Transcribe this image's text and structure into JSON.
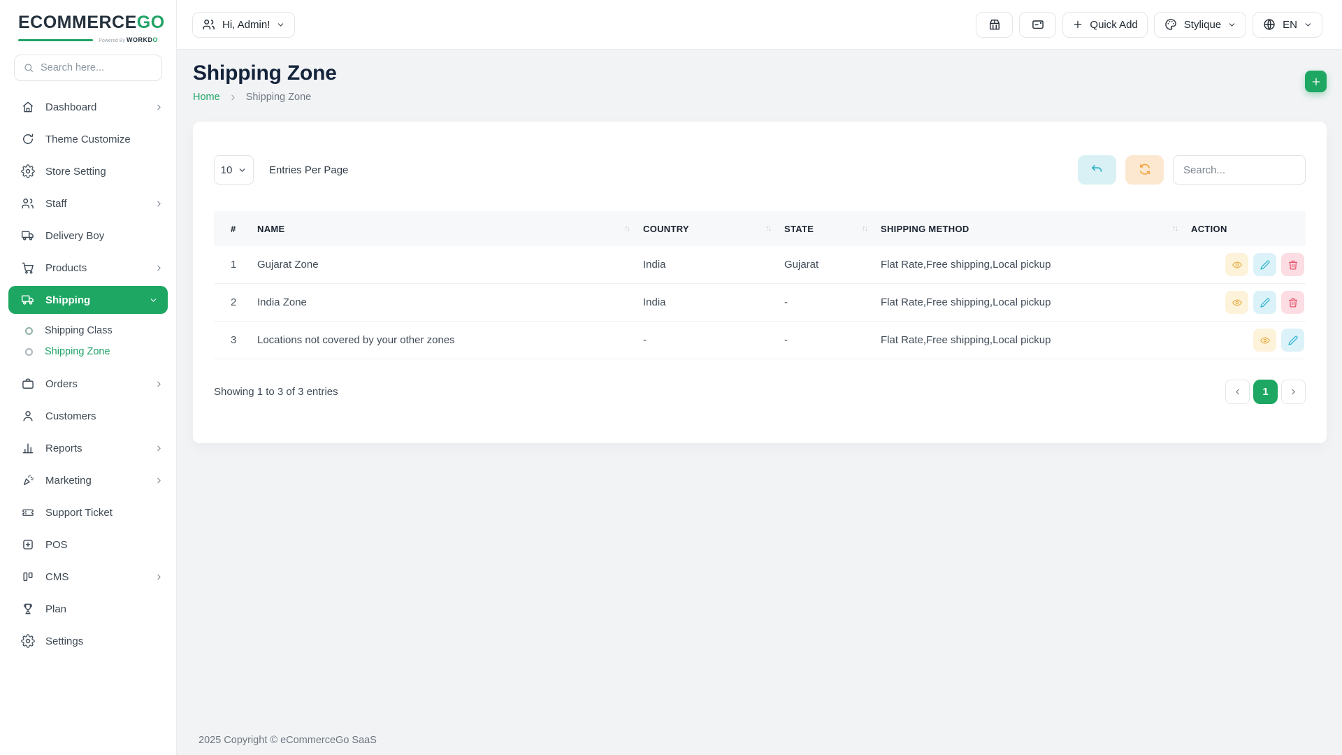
{
  "brand": {
    "name_primary": "ECOMMERCE",
    "name_accent": "GO",
    "powered_by": "Powered By",
    "powered_brand_a": "WORKD",
    "powered_brand_o": "O"
  },
  "colors": {
    "accent_green": "#1ea763",
    "view_orange": "#e9b04b",
    "edit_cyan": "#29b2ca",
    "delete_red": "#e54860"
  },
  "sidebar": {
    "search_placeholder": "Search here...",
    "items": [
      {
        "label": "Dashboard",
        "icon": "home-icon"
      },
      {
        "label": "Theme Customize",
        "icon": "theme-icon"
      },
      {
        "label": "Store Setting",
        "icon": "gear-icon"
      },
      {
        "label": "Staff",
        "icon": "users-icon"
      },
      {
        "label": "Delivery Boy",
        "icon": "truck-icon"
      },
      {
        "label": "Products",
        "icon": "cart-icon"
      },
      {
        "label": "Shipping",
        "icon": "shipping-truck-icon",
        "active": true
      },
      {
        "label": "Orders",
        "icon": "briefcase-icon"
      },
      {
        "label": "Customers",
        "icon": "user-icon"
      },
      {
        "label": "Reports",
        "icon": "bar-chart-icon"
      },
      {
        "label": "Marketing",
        "icon": "megaphone-icon"
      },
      {
        "label": "Support Ticket",
        "icon": "ticket-icon"
      },
      {
        "label": "POS",
        "icon": "pos-icon"
      },
      {
        "label": "CMS",
        "icon": "cms-icon"
      },
      {
        "label": "Plan",
        "icon": "trophy-icon"
      },
      {
        "label": "Settings",
        "icon": "settings-icon"
      }
    ],
    "shipping_subitems": [
      {
        "label": "Shipping Class",
        "active": false
      },
      {
        "label": "Shipping Zone",
        "active": true
      }
    ]
  },
  "header": {
    "greeting": "Hi, Admin!",
    "quick_add_label": "Quick Add",
    "theme_label": "Stylique",
    "language_label": "EN"
  },
  "page": {
    "title": "Shipping Zone",
    "breadcrumb_home": "Home",
    "breadcrumb_current": "Shipping Zone"
  },
  "toolbar": {
    "entries_value": "10",
    "entries_label": "Entries Per Page",
    "search_placeholder": "Search..."
  },
  "table": {
    "headers": {
      "index": "#",
      "name": "NAME",
      "country": "COUNTRY",
      "state": "STATE",
      "method": "SHIPPING METHOD",
      "action": "ACTION"
    },
    "rows": [
      {
        "num": "1",
        "name": "Gujarat Zone",
        "country": "India",
        "state": "Gujarat",
        "method": "Flat Rate,Free shipping,Local pickup"
      },
      {
        "num": "2",
        "name": "India Zone",
        "country": "India",
        "state": "-",
        "method": "Flat Rate,Free shipping,Local pickup"
      },
      {
        "num": "3",
        "name": "Locations not covered by your other zones",
        "country": "-",
        "state": "-",
        "method": "Flat Rate,Free shipping,Local pickup"
      }
    ],
    "summary": "Showing 1 to 3 of 3 entries",
    "pagination_current": "1"
  },
  "footer": {
    "copyright": "2025 Copyright © eCommerceGo SaaS"
  }
}
